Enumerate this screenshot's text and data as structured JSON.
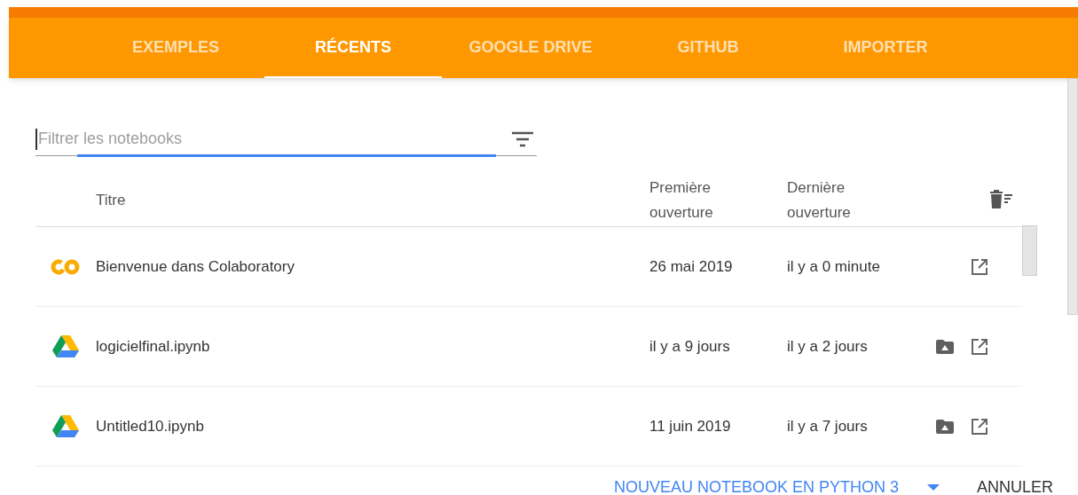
{
  "tabs": [
    {
      "label": "EXEMPLES",
      "selected": false
    },
    {
      "label": "RÉCENTS",
      "selected": true
    },
    {
      "label": "GOOGLE DRIVE",
      "selected": false
    },
    {
      "label": "GITHUB",
      "selected": false
    },
    {
      "label": "IMPORTER",
      "selected": false
    }
  ],
  "filter": {
    "placeholder": "Filtrer les notebooks"
  },
  "table": {
    "columns": [
      "Titre",
      "Première ouverture",
      "Dernière ouverture"
    ],
    "rows": [
      {
        "kind": "colab",
        "title": "Bienvenue dans Colaboratory",
        "first_opened": "26 mai 2019",
        "last_opened": "il y a 0 minute"
      },
      {
        "kind": "drive",
        "title": "logicielfinal.ipynb",
        "first_opened": "il y a 9 jours",
        "last_opened": "il y a 2 jours"
      },
      {
        "kind": "drive",
        "title": "Untitled10.ipynb",
        "first_opened": "11 juin 2019",
        "last_opened": "il y a 7 jours"
      }
    ]
  },
  "footer": {
    "new_button": "NOUVEAU NOTEBOOK EN PYTHON 3",
    "cancel_button": "ANNULER"
  }
}
